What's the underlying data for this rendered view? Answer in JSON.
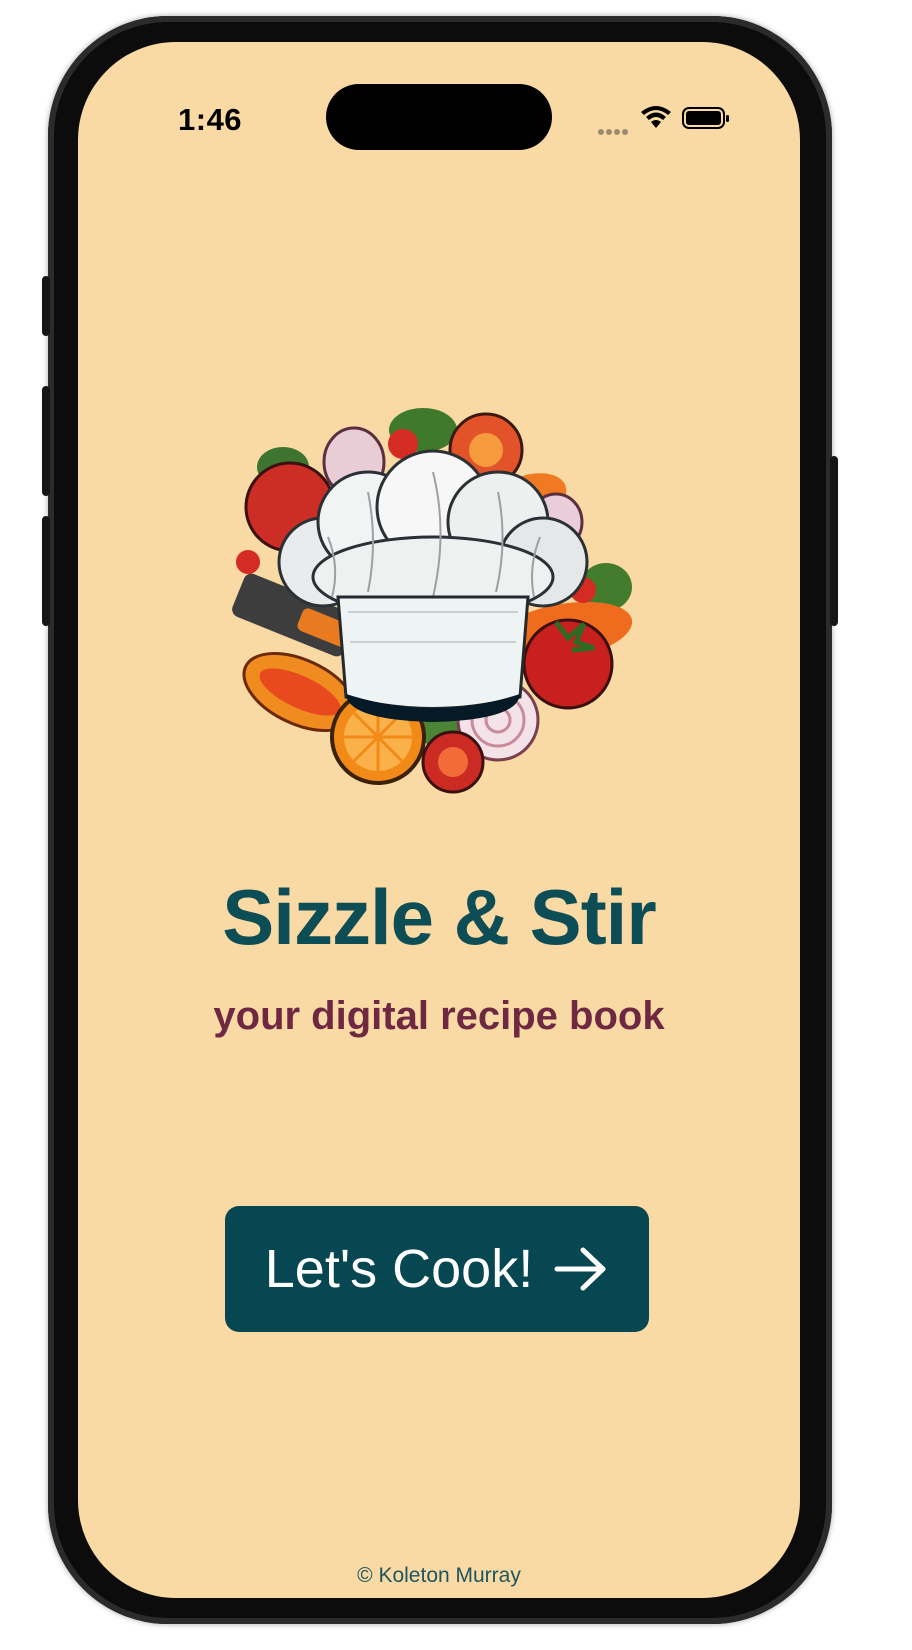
{
  "status_bar": {
    "time": "1:46"
  },
  "app": {
    "title": "Sizzle & Stir",
    "subtitle": "your digital recipe book",
    "cta_label": "Let's Cook!",
    "footer": "© Koleton Murray",
    "logo_icon": "chef-hat-vegetables-logo",
    "cta_icon": "arrow-right-icon"
  },
  "colors": {
    "background": "#f9d9a4",
    "title": "#0d4d55",
    "subtitle": "#6e2841",
    "button": "#074752",
    "footer": "#1e5560"
  }
}
